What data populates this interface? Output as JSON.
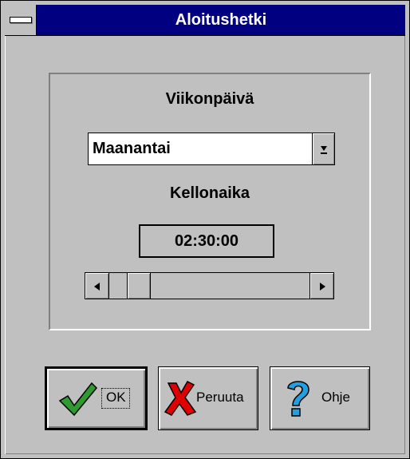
{
  "window": {
    "title": "Aloitushetki"
  },
  "weekday": {
    "label": "Viikonpäivä",
    "selected": "Maanantai",
    "dropdown_glyph": "⭳"
  },
  "time": {
    "label": "Kellonaika",
    "value": "02:30:00",
    "slider_position_fraction": 0.1
  },
  "buttons": {
    "ok": "OK",
    "cancel": "Peruuta",
    "help": "Ohje"
  },
  "colors": {
    "titlebar": "#000080",
    "face": "#c0c0c0",
    "ok_check": "#2f9a2f",
    "cancel_x": "#e00000",
    "help_q": "#20a0e0"
  },
  "icons": {
    "ok": "check-icon",
    "cancel": "x-icon",
    "help": "question-icon"
  }
}
